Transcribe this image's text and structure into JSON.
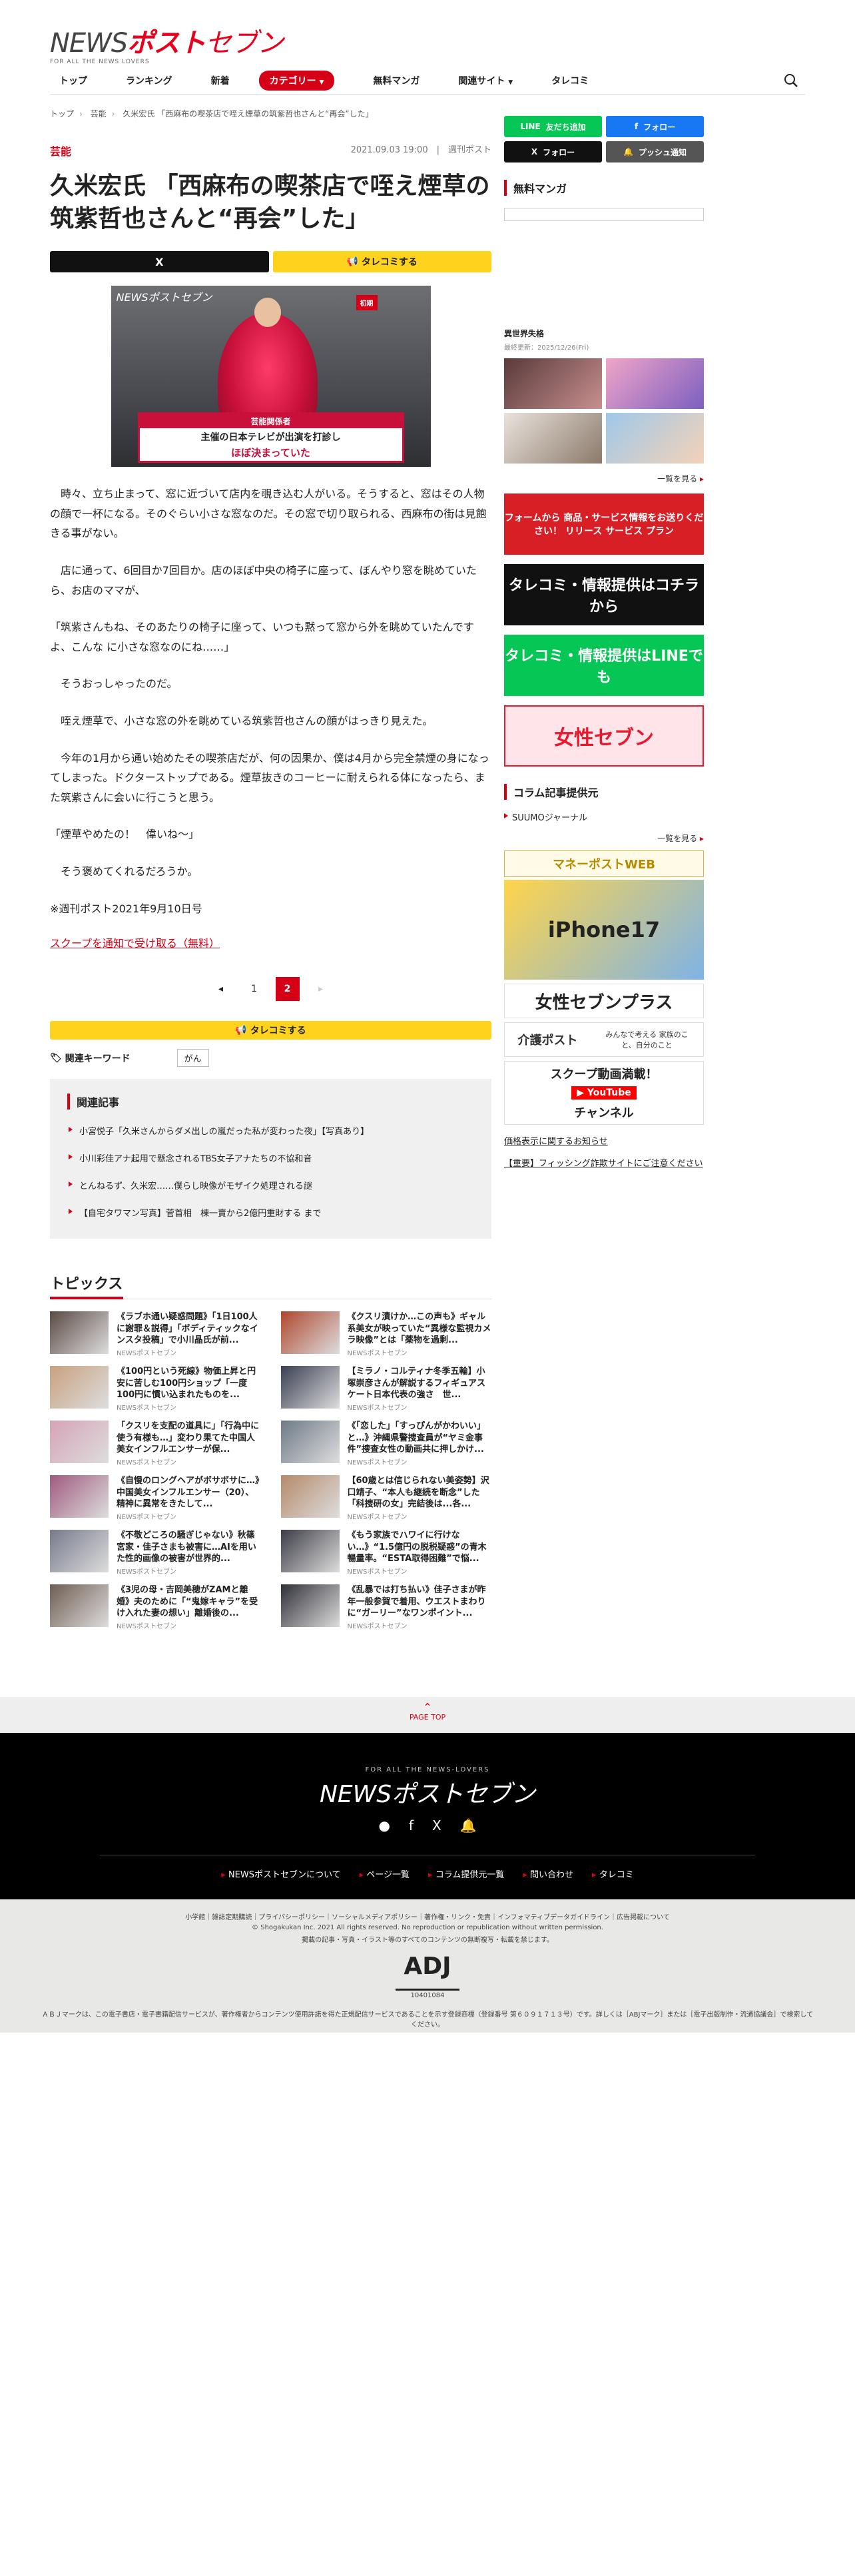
{
  "header": {
    "logo_news": "NEWS",
    "logo_post": "ポスト",
    "logo_seven": "セブン",
    "logo_tagline": "FOR ALL THE NEWS LOVERS",
    "nav": [
      "トップ",
      "ランキング",
      "新着",
      "カテゴリー",
      "無料マンガ",
      "関連サイト",
      "タレコミ"
    ]
  },
  "breadcrumb": [
    "トップ",
    "芸能",
    "久米宏氏 「西麻布の喫茶店で咥え煙草の筑紫哲也さんと“再会”した」"
  ],
  "article": {
    "category": "芸能",
    "date": "2021.09.03 19:00",
    "source": "週刊ポスト",
    "title": "久米宏氏 「西麻布の喫茶店で咥え煙草の筑紫哲也さんと“再会”した」",
    "share_x": "X",
    "share_tareco": "タレコミする",
    "hero": {
      "logo": "NEWSポストセブン",
      "badge": "初期",
      "caption_top": "芸能関係者",
      "caption_main": "主催の日本テレビが出演を打診し",
      "caption_red": "ほぼ決まっていた"
    },
    "paragraphs": [
      "時々、立ち止まって、窓に近づいて店内を覗き込む人がいる。そうすると、窓はその人物の顔で一杯になる。そのぐらい小さな窓なのだ。その窓で切り取られる、西麻布の街は見飽きる事がない。",
      "店に通って、6回目か7回目か。店のほぼ中央の椅子に座って、ぼんやり窓を眺めていたら、お店のママが、",
      "「筑紫さんもね、そのあたりの椅子に座って、いつも黙って窓から外を眺めていたんですよ、こんな に小さな窓なのにね……」",
      "そうおっしゃったのだ。",
      "咥え煙草で、小さな窓の外を眺めている筑紫哲也さんの顔がはっきり見えた。",
      "今年の1月から通い始めたその喫茶店だが、何の因果か、僕は4月から完全禁煙の身になってしまった。ドクターストップである。煙草抜きのコーヒーに耐えられる体になったら、また筑紫さんに会いに行こうと思う。",
      "「煙草やめたの！　偉いね～」",
      "そう褒めてくれるだろうか。",
      "※週刊ポスト2021年9月10日号"
    ],
    "scoop_link": "スクープを通知で受け取る（無料）",
    "pages": [
      "1",
      "2"
    ],
    "current_page": "2",
    "tareco2": "タレコミする",
    "keywords_label": "関連キーワード",
    "keywords": [
      "がん"
    ],
    "related_title": "関連記事",
    "related": [
      "小宮悦子「久米さんからダメ出しの嵐だった私が変わった夜」【写真あり】",
      "小川彩佳アナ起用で懸念されるTBS女子アナたちの不協和音",
      "とんねるず、久米宏……僕らし映像がモザイク処理される謎",
      "【自宅タワマン写真】菅首相　棟一賣から2億円重財する まで"
    ]
  },
  "topics": {
    "title": "トピックス",
    "items": [
      {
        "title": "《ラブホ通い疑惑問題》「1日100人に謝罪＆説得」「ボディティックなインスタ投稿」で小川晶氏が前...",
        "src": "NEWSポストセブン"
      },
      {
        "title": "《クスリ漬けか…この声も》ギャル系美女が映っていた“異様な監視カメラ映像”とは「薬物を過剰...",
        "src": "NEWSポストセブン"
      },
      {
        "title": "《100円という死線》物価上昇と円安に苦しむ100円ショップ「一度100円に慣い込まれたものを...",
        "src": "NEWSポストセブン"
      },
      {
        "title": "【ミラノ・コルティナ冬季五輪】小塚崇彦さんが解説するフィギュアスケート日本代表の強さ　世...",
        "src": "NEWSポストセブン"
      },
      {
        "title": "「クスリを支配の道具に」「行為中に使う有様も…」変わり果てた中国人美女インフルエンサーが保...",
        "src": "NEWSポストセブン"
      },
      {
        "title": "《「恋した」「すっぴんがかわいい」と…》沖縄県警捜査員が“ヤミ金事件”捜査女性の動画共に押しかけ...",
        "src": "NEWSポストセブン"
      },
      {
        "title": "《自慢のロングヘアがボサボサに…》中国美女インフルエンサー（20）、精神に異常をきたして...",
        "src": "NEWSポストセブン"
      },
      {
        "title": "【60歳とは信じられない美姿勢】沢口靖子、“本人も継続を断念”した「科捜研の女」完結後は...各...",
        "src": "NEWSポストセブン"
      },
      {
        "title": "《不敬どころの騒ぎじゃない》秋篠宮家・佳子さまも被害に…AIを用いた性的画像の被害が世界的...",
        "src": "NEWSポストセブン"
      },
      {
        "title": "《もう家族でハワイに行けない…》“1.5億円の脱税疑惑”の青木暢量率。“ESTA取得困難”で悩...",
        "src": "NEWSポストセブン"
      },
      {
        "title": "《3児の母・吉岡美穂がZAMと離婚》夫のために「“鬼嫁キャラ”を受け入れた妻の想い」離婚後の...",
        "src": "NEWSポストセブン"
      },
      {
        "title": "《乱暴では打ち払い》佳子さまが昨年一般参賀で着用、ウエストまわりに“ガーリー”なワンポイント...",
        "src": "NEWSポストセブン"
      }
    ]
  },
  "sidebar": {
    "sns": [
      {
        "label": "友だち追加",
        "color": "#06c755"
      },
      {
        "label": "フォロー",
        "color": "#1877f2"
      },
      {
        "label": "フォロー",
        "color": "#111111"
      },
      {
        "label": "プッシュ通知",
        "color": "#555555"
      }
    ],
    "manga_title": "無料マンガ",
    "manga_sub": "異世界失格",
    "manga_updated": "最終更新：2025/12/26(Fri)",
    "more1": "一覧を見る",
    "banners": [
      {
        "text": "フォームから 商品・サービス情報をお送りください！ リリース サービス プラン",
        "color": "#d81f26"
      },
      {
        "text": "タレコミ・情報提供はコチラから",
        "color": "#111111"
      },
      {
        "text": "タレコミ・情報提供はLINEでも",
        "color": "#06c755"
      },
      {
        "text": "女性セブン",
        "color": "#e8192c"
      }
    ],
    "column_title": "コラム記事提供元",
    "column_item": "SUUMOジャーナル",
    "more2": "一覧を見る",
    "mp_title": "マネーポストWEB",
    "mp_promo": "iPhone17",
    "josei_plus": "女性セブンプラス",
    "kaigo": "介護ポスト",
    "kaigo_sub": "みんなで考える 家族のこと、自分のこと",
    "youtube_1": "スクープ動画満載！",
    "youtube_2": "チャンネル",
    "link1": "価格表示に関するお知らせ",
    "link2": "【重要】フィッシング詐欺サイトにご注意ください"
  },
  "footer": {
    "pagetop": "PAGE TOP",
    "tagline": "FOR ALL THE NEWS-LOVERS",
    "logo": "NEWSポストセブン",
    "nav": [
      "NEWSポストセブンについて",
      "ページ一覧",
      "コラム提供元一覧",
      "問い合わせ",
      "タレコミ"
    ],
    "legal_links": "小学館｜雑誌定期購読｜プライバシーポリシー｜ソーシャルメディアポリシー｜著作権・リンク・免責｜インフォマティブデータガイドライン｜広告掲載について",
    "copyright": "© Shogakukan Inc. 2021 All rights reserved. No reproduction or republication without written permission.",
    "copyright_jp": "掲載の記事・写真・イラスト等のすべてのコンテンツの無断複写・転載を禁じます。",
    "adj": "ADJ",
    "adj_num": "10401084",
    "adj_note": "ＡＢＪマークは、この電子書店・電子書籍配信サービスが、著作権者からコンテンツ使用許諾を得た正規配信サービスであることを示す登録商標（登録番号 第６０９１７１３号）です。詳しくは［ABJマーク］または［電子出版制作・流通協議会］で検索してください。"
  }
}
